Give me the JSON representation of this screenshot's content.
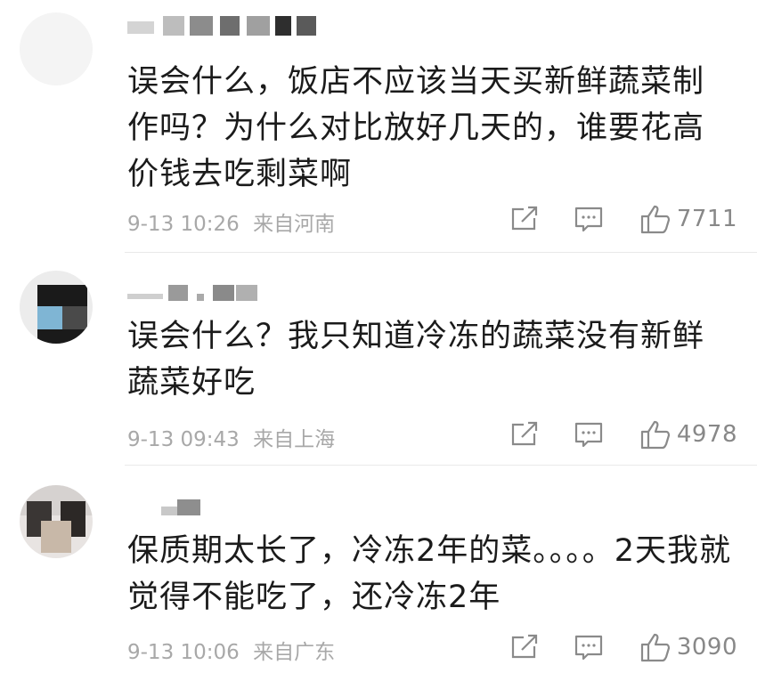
{
  "comments": [
    {
      "text": "误会什么，饭店不应该当天买新鲜蔬菜制作吗？为什么对比放好几天的，谁要花高价钱去吃剩菜啊",
      "time": "9-13 10:26",
      "location": "来自河南",
      "likes": "7711"
    },
    {
      "text": "误会什么？我只知道冷冻的蔬菜没有新鲜蔬菜好吃",
      "time": "9-13 09:43",
      "location": "来自上海",
      "likes": "4978"
    },
    {
      "text": "保质期太长了，冷冻2年的菜。。。。2天我就觉得不能吃了，还冷冻2年",
      "time": "9-13 10:06",
      "location": "来自广东",
      "likes": "3090"
    }
  ],
  "icons": {
    "share": "share-icon",
    "reply": "comment-icon",
    "like": "thumbs-up-icon"
  },
  "colors": {
    "text": "#1b1b1b",
    "meta": "#a8a8a8",
    "icon": "#8a8a8a"
  }
}
